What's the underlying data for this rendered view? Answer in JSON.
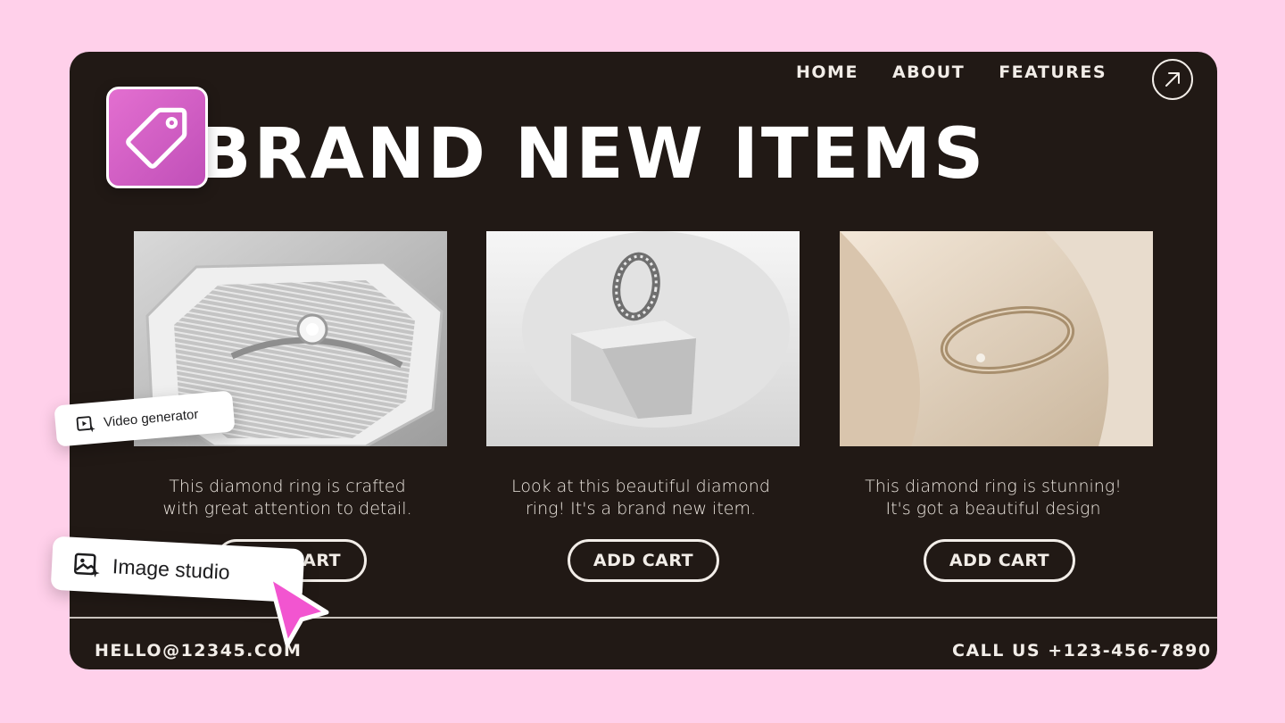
{
  "nav": {
    "items": [
      "HOME",
      "ABOUT",
      "FEATURES"
    ],
    "external_link": "arrow-up-right-icon"
  },
  "hero": {
    "headline": "BRAND NEW ITEMS"
  },
  "products": [
    {
      "line1": "This diamond ring is crafted",
      "line2": "with great attention to detail.",
      "button": "ADD CART",
      "image": "diamond ring in box"
    },
    {
      "line1": "Look at this beautiful diamond",
      "line2": "ring! It's a brand new item.",
      "button": "ADD CART",
      "image": "diamond band on pedestal"
    },
    {
      "line1": "This diamond ring is stunning!",
      "line2": "It's got a beautiful design",
      "button": "ADD CART",
      "image": "gold ring on cream paper"
    }
  ],
  "footer": {
    "email": "HELLO@12345.COM",
    "phone": "CALL US +123-456-7890"
  },
  "overlays": {
    "video_chip": "Video generator",
    "image_chip": "Image studio"
  },
  "colors": {
    "background": "#ffd0ea",
    "card": "#211915",
    "accent": "#e36fd0"
  }
}
